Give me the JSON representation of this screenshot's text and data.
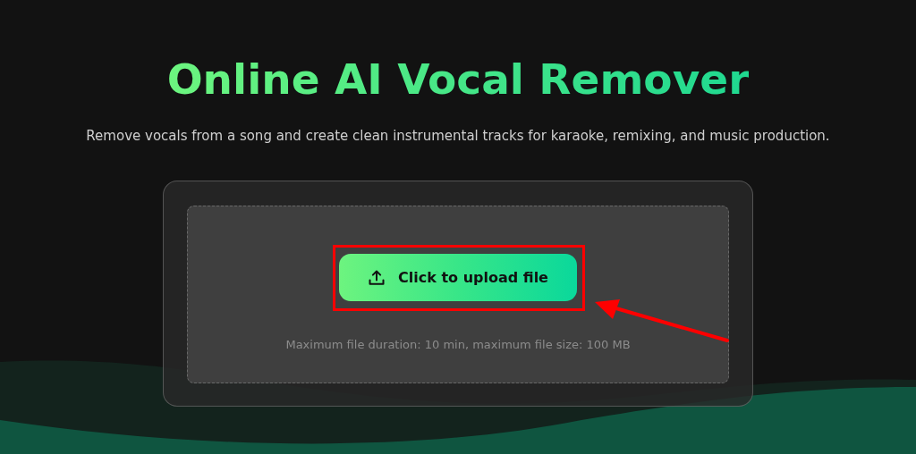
{
  "header": {
    "title": "Online AI Vocal Remover",
    "subtitle": "Remove vocals from a song and create clean instrumental tracks for karaoke, remixing, and music production."
  },
  "upload": {
    "button": "Click to upload file",
    "hint": "Maximum file duration: 10 min, maximum file size: 100 MB"
  }
}
